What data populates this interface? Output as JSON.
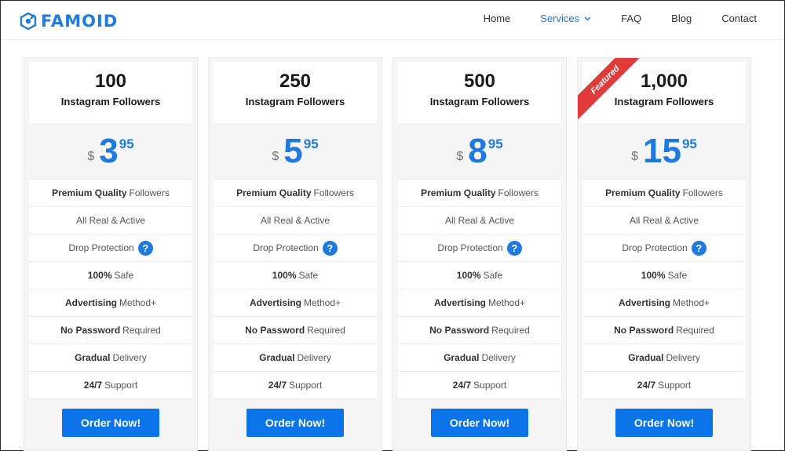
{
  "brand": {
    "name": "FAMOID",
    "color": "#1d7ae0"
  },
  "nav": [
    {
      "label": "Home",
      "active": false,
      "dropdown": false
    },
    {
      "label": "Services",
      "active": true,
      "dropdown": true
    },
    {
      "label": "FAQ",
      "active": false,
      "dropdown": false
    },
    {
      "label": "Blog",
      "active": false,
      "dropdown": false
    },
    {
      "label": "Contact",
      "active": false,
      "dropdown": false
    }
  ],
  "plans": [
    {
      "quantity": "100",
      "label": "Instagram Followers",
      "currency": "$",
      "price_main": "3",
      "price_cents": "95",
      "featured": false
    },
    {
      "quantity": "250",
      "label": "Instagram Followers",
      "currency": "$",
      "price_main": "5",
      "price_cents": "95",
      "featured": false
    },
    {
      "quantity": "500",
      "label": "Instagram Followers",
      "currency": "$",
      "price_main": "8",
      "price_cents": "95",
      "featured": false
    },
    {
      "quantity": "1,000",
      "label": "Instagram Followers",
      "currency": "$",
      "price_main": "15",
      "price_cents": "95",
      "featured": true,
      "ribbon": "Featured"
    }
  ],
  "features": [
    {
      "bold": "Premium Quality",
      "rest": "Followers",
      "help": false
    },
    {
      "bold": "",
      "rest": "All Real & Active",
      "help": false
    },
    {
      "bold": "",
      "rest": "Drop Protection",
      "help": true
    },
    {
      "bold": "100%",
      "rest": "Safe",
      "help": false
    },
    {
      "bold": "Advertising",
      "rest": "Method+",
      "help": false
    },
    {
      "bold": "No Password",
      "rest": "Required",
      "help": false
    },
    {
      "bold": "Gradual",
      "rest": "Delivery",
      "help": false
    },
    {
      "bold": "24/7",
      "rest": "Support",
      "help": false
    }
  ],
  "help_icon_glyph": "?",
  "order_label": "Order Now!"
}
